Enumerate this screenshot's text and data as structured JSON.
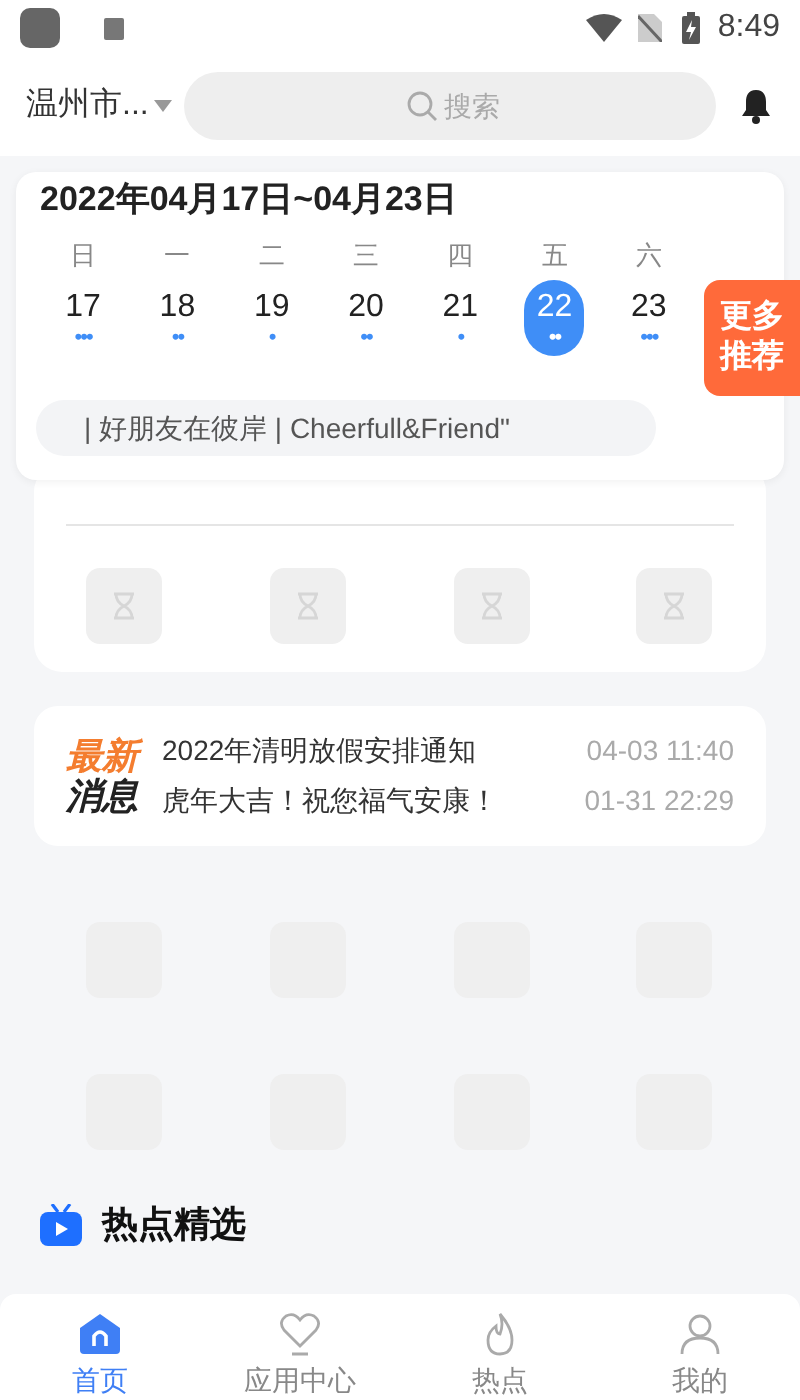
{
  "status_bar": {
    "time": "8:49"
  },
  "header": {
    "location": "温州市...",
    "search": {
      "placeholder": "搜索"
    }
  },
  "calendar": {
    "title": "2022年04月17日~04月23日",
    "days": [
      {
        "weekday": "日",
        "date": "17",
        "dots": "•••",
        "selected": false
      },
      {
        "weekday": "一",
        "date": "18",
        "dots": "••",
        "selected": false
      },
      {
        "weekday": "二",
        "date": "19",
        "dots": "•",
        "selected": false
      },
      {
        "weekday": "三",
        "date": "20",
        "dots": "••",
        "selected": false
      },
      {
        "weekday": "四",
        "date": "21",
        "dots": "•",
        "selected": false
      },
      {
        "weekday": "五",
        "date": "22",
        "dots": "••",
        "selected": true
      },
      {
        "weekday": "六",
        "date": "23",
        "dots": "•••",
        "selected": false
      }
    ],
    "ticker": "| 好朋友在彼岸 | Cheerfull&Friend\""
  },
  "more_button": {
    "label": "更多推荐"
  },
  "shortcut_tiles": [
    {
      "kind": "loading"
    },
    {
      "kind": "loading"
    },
    {
      "kind": "loading"
    },
    {
      "kind": "loading"
    }
  ],
  "news": {
    "label_top": "最新",
    "label_bottom": "消息",
    "items": [
      {
        "title": "2022年清明放假安排通知",
        "time": "04-03 11:40"
      },
      {
        "title": "虎年大吉！祝您福气安康！",
        "time": "01-31 22:29"
      }
    ]
  },
  "app_tiles": [
    {
      "kind": "blank"
    },
    {
      "kind": "blank"
    },
    {
      "kind": "blank"
    },
    {
      "kind": "blank"
    },
    {
      "kind": "blank"
    },
    {
      "kind": "blank"
    },
    {
      "kind": "blank"
    },
    {
      "kind": "blank"
    }
  ],
  "section": {
    "title": "热点精选"
  },
  "tab_bar": [
    {
      "label": "首页",
      "selected": true,
      "kind": "home"
    },
    {
      "label": "应用中心",
      "selected": false,
      "kind": "apps"
    },
    {
      "label": "热点",
      "selected": false,
      "kind": "hot"
    },
    {
      "label": "我的",
      "selected": false,
      "kind": "me"
    }
  ]
}
